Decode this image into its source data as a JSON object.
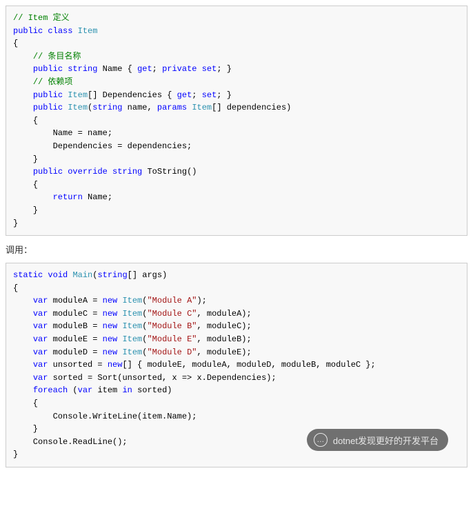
{
  "block1": {
    "lines": [
      [
        [
          "c",
          "// Item 定义"
        ]
      ],
      [
        [
          "kw",
          "public"
        ],
        [
          "p",
          " "
        ],
        [
          "kw",
          "class"
        ],
        [
          "p",
          " "
        ],
        [
          "ty",
          "Item"
        ]
      ],
      [
        [
          "p",
          "{"
        ]
      ],
      [
        [
          "p",
          "    "
        ],
        [
          "c",
          "// 条目名称"
        ]
      ],
      [
        [
          "p",
          "    "
        ],
        [
          "kw",
          "public"
        ],
        [
          "p",
          " "
        ],
        [
          "kw",
          "string"
        ],
        [
          "p",
          " Name { "
        ],
        [
          "kw",
          "get"
        ],
        [
          "p",
          "; "
        ],
        [
          "kw",
          "private"
        ],
        [
          "p",
          " "
        ],
        [
          "kw",
          "set"
        ],
        [
          "p",
          "; }"
        ]
      ],
      [
        [
          "p",
          "    "
        ],
        [
          "c",
          "// 依赖项"
        ]
      ],
      [
        [
          "p",
          "    "
        ],
        [
          "kw",
          "public"
        ],
        [
          "p",
          " "
        ],
        [
          "ty",
          "Item"
        ],
        [
          "p",
          "[] Dependencies { "
        ],
        [
          "kw",
          "get"
        ],
        [
          "p",
          "; "
        ],
        [
          "kw",
          "set"
        ],
        [
          "p",
          "; }"
        ]
      ],
      [
        [
          "p",
          ""
        ]
      ],
      [
        [
          "p",
          "    "
        ],
        [
          "kw",
          "public"
        ],
        [
          "p",
          " "
        ],
        [
          "ty",
          "Item"
        ],
        [
          "p",
          "("
        ],
        [
          "kw",
          "string"
        ],
        [
          "p",
          " name, "
        ],
        [
          "kw",
          "params"
        ],
        [
          "p",
          " "
        ],
        [
          "ty",
          "Item"
        ],
        [
          "p",
          "[] dependencies)"
        ]
      ],
      [
        [
          "p",
          "    {"
        ]
      ],
      [
        [
          "p",
          "        Name = name;"
        ]
      ],
      [
        [
          "p",
          "        Dependencies = dependencies;"
        ]
      ],
      [
        [
          "p",
          "    }"
        ]
      ],
      [
        [
          "p",
          ""
        ]
      ],
      [
        [
          "p",
          "    "
        ],
        [
          "kw",
          "public"
        ],
        [
          "p",
          " "
        ],
        [
          "kw",
          "override"
        ],
        [
          "p",
          " "
        ],
        [
          "kw",
          "string"
        ],
        [
          "p",
          " ToString()"
        ]
      ],
      [
        [
          "p",
          "    {"
        ]
      ],
      [
        [
          "p",
          "        "
        ],
        [
          "kw",
          "return"
        ],
        [
          "p",
          " Name;"
        ]
      ],
      [
        [
          "p",
          "    }"
        ]
      ],
      [
        [
          "p",
          "}"
        ]
      ]
    ]
  },
  "caption1": "调用：",
  "block2": {
    "lines": [
      [
        [
          "kw",
          "static"
        ],
        [
          "p",
          " "
        ],
        [
          "kw",
          "void"
        ],
        [
          "p",
          " "
        ],
        [
          "ty",
          "Main"
        ],
        [
          "p",
          "("
        ],
        [
          "kw",
          "string"
        ],
        [
          "p",
          "[] args)"
        ]
      ],
      [
        [
          "p",
          "{"
        ]
      ],
      [
        [
          "p",
          "    "
        ],
        [
          "kw",
          "var"
        ],
        [
          "p",
          " moduleA = "
        ],
        [
          "kw",
          "new"
        ],
        [
          "p",
          " "
        ],
        [
          "ty",
          "Item"
        ],
        [
          "p",
          "("
        ],
        [
          "st",
          "\"Module A\""
        ],
        [
          "p",
          ");"
        ]
      ],
      [
        [
          "p",
          "    "
        ],
        [
          "kw",
          "var"
        ],
        [
          "p",
          " moduleC = "
        ],
        [
          "kw",
          "new"
        ],
        [
          "p",
          " "
        ],
        [
          "ty",
          "Item"
        ],
        [
          "p",
          "("
        ],
        [
          "st",
          "\"Module C\""
        ],
        [
          "p",
          ", moduleA);"
        ]
      ],
      [
        [
          "p",
          "    "
        ],
        [
          "kw",
          "var"
        ],
        [
          "p",
          " moduleB = "
        ],
        [
          "kw",
          "new"
        ],
        [
          "p",
          " "
        ],
        [
          "ty",
          "Item"
        ],
        [
          "p",
          "("
        ],
        [
          "st",
          "\"Module B\""
        ],
        [
          "p",
          ", moduleC);"
        ]
      ],
      [
        [
          "p",
          "    "
        ],
        [
          "kw",
          "var"
        ],
        [
          "p",
          " moduleE = "
        ],
        [
          "kw",
          "new"
        ],
        [
          "p",
          " "
        ],
        [
          "ty",
          "Item"
        ],
        [
          "p",
          "("
        ],
        [
          "st",
          "\"Module E\""
        ],
        [
          "p",
          ", moduleB);"
        ]
      ],
      [
        [
          "p",
          "    "
        ],
        [
          "kw",
          "var"
        ],
        [
          "p",
          " moduleD = "
        ],
        [
          "kw",
          "new"
        ],
        [
          "p",
          " "
        ],
        [
          "ty",
          "Item"
        ],
        [
          "p",
          "("
        ],
        [
          "st",
          "\"Module D\""
        ],
        [
          "p",
          ", moduleE);"
        ]
      ],
      [
        [
          "p",
          ""
        ]
      ],
      [
        [
          "p",
          "    "
        ],
        [
          "kw",
          "var"
        ],
        [
          "p",
          " unsorted = "
        ],
        [
          "kw",
          "new"
        ],
        [
          "p",
          "[] { moduleE, moduleA, moduleD, moduleB, moduleC };"
        ]
      ],
      [
        [
          "p",
          ""
        ]
      ],
      [
        [
          "p",
          "    "
        ],
        [
          "kw",
          "var"
        ],
        [
          "p",
          " sorted = Sort(unsorted, x => x.Dependencies);"
        ]
      ],
      [
        [
          "p",
          ""
        ]
      ],
      [
        [
          "p",
          "    "
        ],
        [
          "kw",
          "foreach"
        ],
        [
          "p",
          " ("
        ],
        [
          "kw",
          "var"
        ],
        [
          "p",
          " item "
        ],
        [
          "kw",
          "in"
        ],
        [
          "p",
          " sorted)"
        ]
      ],
      [
        [
          "p",
          "    {"
        ]
      ],
      [
        [
          "p",
          "        Console.WriteLine(item.Name);"
        ]
      ],
      [
        [
          "p",
          "    }"
        ]
      ],
      [
        [
          "p",
          ""
        ]
      ],
      [
        [
          "p",
          "    Console.ReadLine();"
        ]
      ],
      [
        [
          "p",
          "}"
        ]
      ]
    ]
  },
  "watermark": {
    "logo_glyph": "…",
    "text": "dotnet发现更好的开发平台"
  }
}
